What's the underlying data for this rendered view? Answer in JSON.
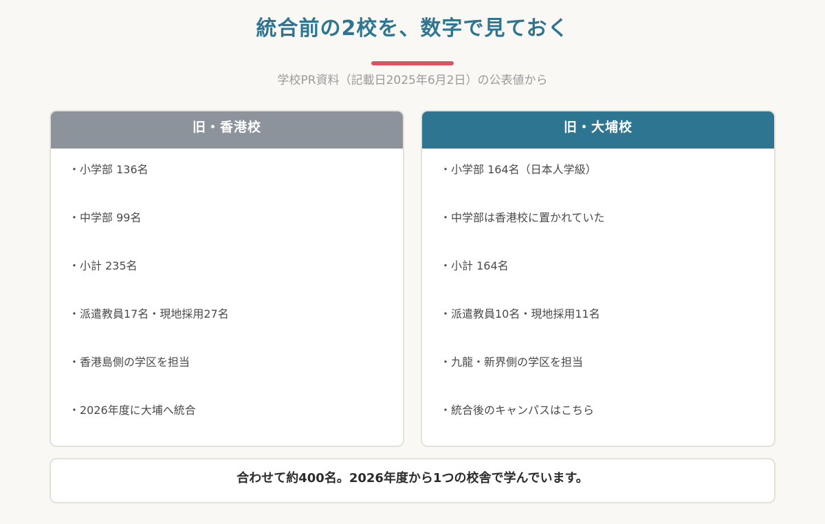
{
  "header": {
    "title": "統合前の2校を、数字で見ておく",
    "subtitle": "学校PR資料（記載日2025年6月2日）の公表値から",
    "accent_color": "#e0525f",
    "title_color": "#2e7591"
  },
  "cards": [
    {
      "title": "旧・香港校",
      "header_color": "#8c939b",
      "items": [
        "・小学部 136名",
        "・中学部 99名",
        "・小計 235名",
        "・派遣教員17名・現地採用27名",
        "・香港島側の学区を担当",
        "・2026年度に大埔へ統合"
      ]
    },
    {
      "title": "旧・大埔校",
      "header_color": "#2e7591",
      "items": [
        "・小学部 164名（日本人学級）",
        "・中学部は香港校に置かれていた",
        "・小計 164名",
        "・派遣教員10名・現地採用11名",
        "・九龍・新界側の学区を担当",
        "・統合後のキャンパスはこちら"
      ]
    }
  ],
  "summary": {
    "text": "合わせて約400名。2026年度から1つの校舎で学んでいます。"
  }
}
